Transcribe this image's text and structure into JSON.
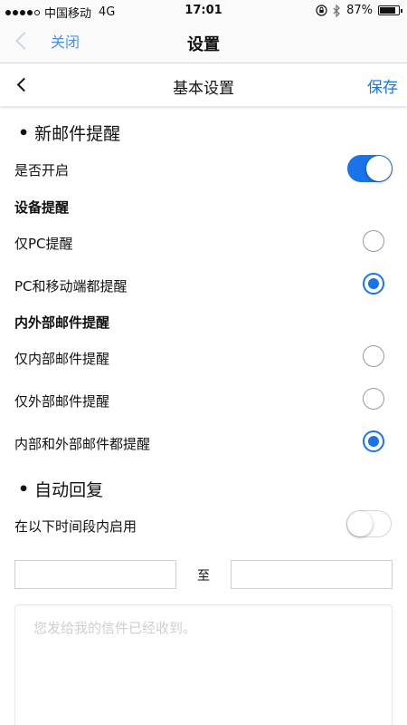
{
  "status_bar": {
    "carrier": "中国移动",
    "network": "4G",
    "time": "17:01",
    "battery": "87%",
    "battery_level": 0.87
  },
  "outer_nav": {
    "close_label": "关闭",
    "title": "设置"
  },
  "inner_nav": {
    "title": "基本设置",
    "save_label": "保存"
  },
  "new_mail_alert": {
    "bullet": "•",
    "title": "新邮件提醒",
    "enable_label": "是否开启",
    "enabled": true,
    "device_group": {
      "label": "设备提醒",
      "options": [
        {
          "label": "仅PC提醒",
          "checked": false
        },
        {
          "label": "PC和移动端都提醒",
          "checked": true
        }
      ]
    },
    "scope_group": {
      "label": "内外部邮件提醒",
      "options": [
        {
          "label": "仅内部邮件提醒",
          "checked": false
        },
        {
          "label": "仅外部邮件提醒",
          "checked": false
        },
        {
          "label": "内部和外部邮件都提醒",
          "checked": true
        }
      ]
    }
  },
  "auto_reply": {
    "bullet": "•",
    "title": "自动回复",
    "period_label": "在以下时间段内启用",
    "period_enabled": false,
    "start_value": "",
    "to_label": "至",
    "end_value": "",
    "message_placeholder": "您发给我的信件已经收到。"
  },
  "colors": {
    "accent": "#1a73e8",
    "link": "#4a90e2"
  }
}
